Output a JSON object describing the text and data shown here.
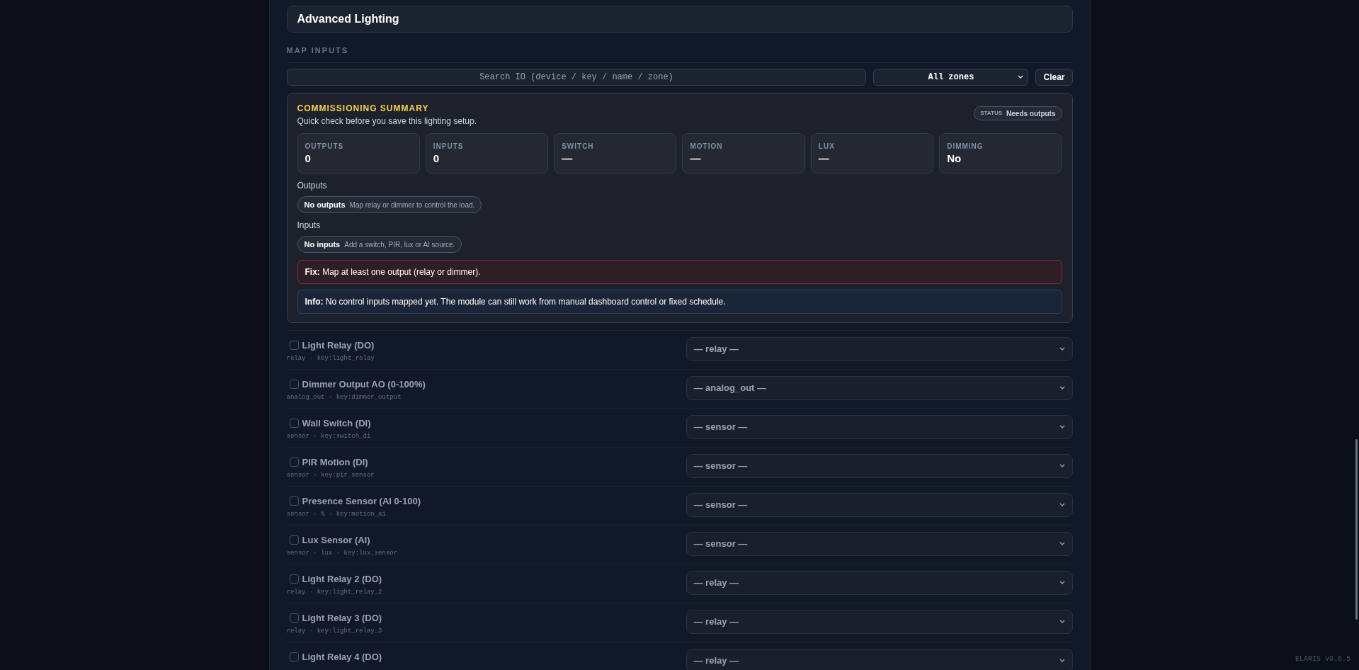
{
  "header": {
    "title": "Advanced Lighting"
  },
  "section": {
    "title": "MAP INPUTS"
  },
  "filters": {
    "search_placeholder": "Search IO (device / key / name / zone)",
    "zone": "All zones",
    "clear": "Clear"
  },
  "summary": {
    "title": "COMMISSIONING SUMMARY",
    "subtitle": "Quick check before you save this lighting setup.",
    "status_label": "STATUS",
    "status": "Needs outputs",
    "stats": [
      {
        "label": "OUTPUTS",
        "value": "0"
      },
      {
        "label": "INPUTS",
        "value": "0"
      },
      {
        "label": "SWITCH",
        "value": "—"
      },
      {
        "label": "MOTION",
        "value": "—"
      },
      {
        "label": "LUX",
        "value": "—"
      },
      {
        "label": "DIMMING",
        "value": "No"
      }
    ],
    "groups": [
      {
        "title": "Outputs",
        "chip_title": "No outputs",
        "chip_text": "Map relay or dimmer to control the load."
      },
      {
        "title": "Inputs",
        "chip_title": "No inputs",
        "chip_text": "Add a switch, PIR, lux or AI source."
      }
    ],
    "notices": [
      {
        "kind": "fix",
        "label": "Fix:",
        "text": "Map at least one output (relay or dimmer)."
      },
      {
        "kind": "info",
        "label": "Info:",
        "text": "No control inputs mapped yet. The module can still work from manual dashboard control or fixed schedule."
      }
    ]
  },
  "rows": [
    {
      "label": "Light Relay (DO)",
      "meta": "relay · key:light_relay",
      "select": "— relay —",
      "checked": false
    },
    {
      "label": "Dimmer Output AO (0-100%)",
      "meta": "analog_out · key:dimmer_output",
      "select": "— analog_out —",
      "checked": false
    },
    {
      "label": "Wall Switch (DI)",
      "meta": "sensor · key:switch_di",
      "select": "— sensor —",
      "checked": false
    },
    {
      "label": "PIR Motion (DI)",
      "meta": "sensor · key:pir_sensor",
      "select": "— sensor —",
      "checked": false
    },
    {
      "label": "Presence Sensor (AI 0-100)",
      "meta": "sensor · % · key:motion_ai",
      "select": "— sensor —",
      "checked": false
    },
    {
      "label": "Lux Sensor (AI)",
      "meta": "sensor · lux · key:lux_sensor",
      "select": "— sensor —",
      "checked": false
    },
    {
      "label": "Light Relay 2 (DO)",
      "meta": "relay · key:light_relay_2",
      "select": "— relay —",
      "checked": false
    },
    {
      "label": "Light Relay 3 (DO)",
      "meta": "relay · key:light_relay_3",
      "select": "— relay —",
      "checked": false
    },
    {
      "label": "Light Relay 4 (DO)",
      "select": "— relay —",
      "checked": false
    }
  ],
  "footer": {
    "version": "ELARIS v0.6.5"
  }
}
